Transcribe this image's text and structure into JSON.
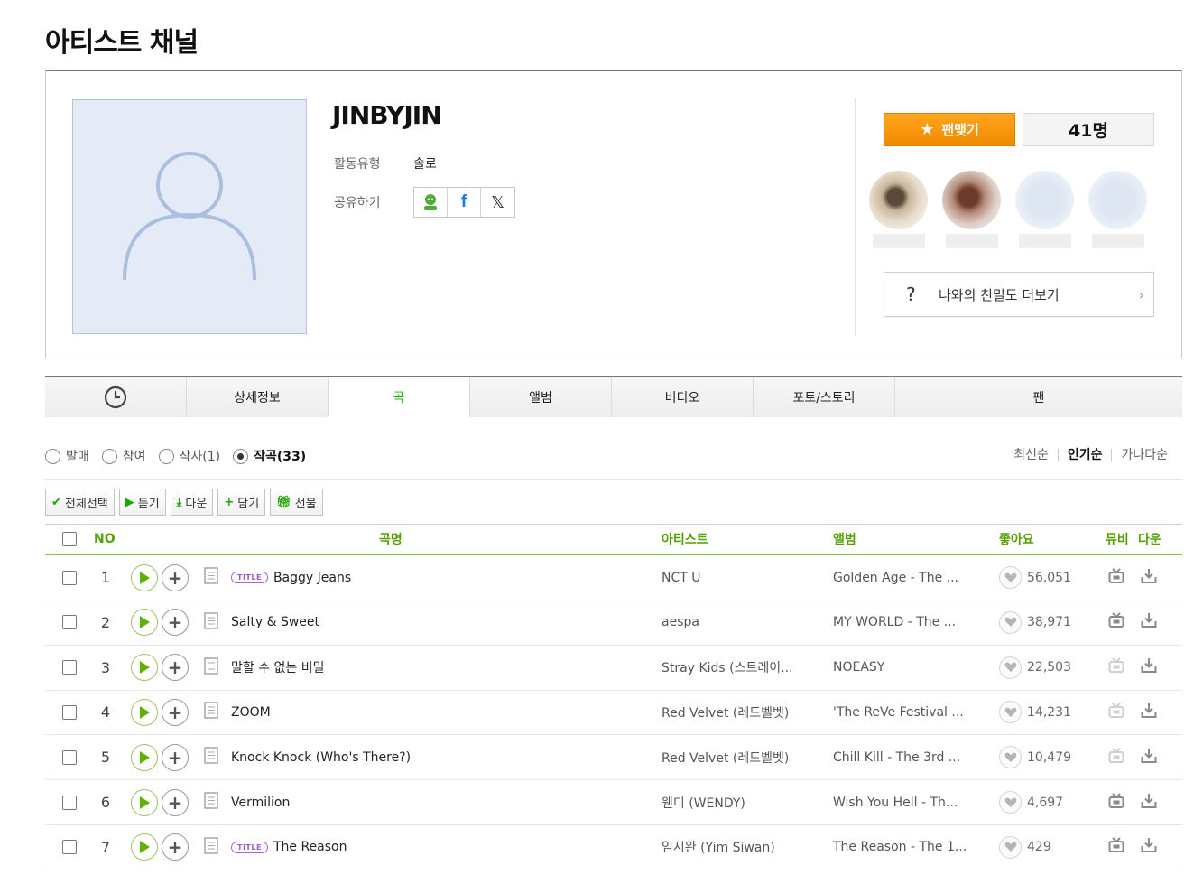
{
  "page_title": "아티스트 채널",
  "artist": {
    "name": "JINBYJIN",
    "activity_label": "활동유형",
    "activity_value": "솔로",
    "share_label": "공유하기"
  },
  "fan": {
    "button_label": "팬맺기",
    "count": "41명",
    "closeness_label": "나와의 친밀도 더보기"
  },
  "tabs": [
    {
      "label": ""
    },
    {
      "label": "상세정보"
    },
    {
      "label": "곡"
    },
    {
      "label": "앨범"
    },
    {
      "label": "비디오"
    },
    {
      "label": "포토/스토리"
    },
    {
      "label": "팬"
    }
  ],
  "filters": [
    {
      "label": "발매",
      "selected": false
    },
    {
      "label": "참여",
      "selected": false
    },
    {
      "label": "작사(1)",
      "selected": false
    },
    {
      "label": "작곡(33)",
      "selected": true
    }
  ],
  "sorts": [
    {
      "label": "최신순",
      "selected": false
    },
    {
      "label": "인기순",
      "selected": true
    },
    {
      "label": "가나다순",
      "selected": false
    }
  ],
  "actions": {
    "select_all": "전체선택",
    "listen": "듣기",
    "download": "다운",
    "add": "담기",
    "gift": "선물"
  },
  "table": {
    "headers": {
      "no": "NO",
      "song": "곡명",
      "artist": "아티스트",
      "album": "앨범",
      "like": "좋아요",
      "mv": "뮤비",
      "down": "다운"
    },
    "title_badge": "TITLE",
    "rows": [
      {
        "no": "1",
        "song": "Baggy Jeans",
        "title": true,
        "artist": "NCT U",
        "album": "Golden Age - The ...",
        "likes": "56,051",
        "mv": true
      },
      {
        "no": "2",
        "song": "Salty & Sweet",
        "title": false,
        "artist": "aespa",
        "album": "MY WORLD - The ...",
        "likes": "38,971",
        "mv": true
      },
      {
        "no": "3",
        "song": "말할 수 없는 비밀",
        "title": false,
        "artist": "Stray Kids (스트레이...",
        "album": "NOEASY",
        "likes": "22,503",
        "mv": false
      },
      {
        "no": "4",
        "song": "ZOOM",
        "title": false,
        "artist": "Red Velvet (레드벨벳)",
        "album": "'The ReVe Festival ...",
        "likes": "14,231",
        "mv": false
      },
      {
        "no": "5",
        "song": "Knock Knock (Who's There?)",
        "title": false,
        "artist": "Red Velvet (레드벨벳)",
        "album": "Chill Kill - The 3rd ...",
        "likes": "10,479",
        "mv": false
      },
      {
        "no": "6",
        "song": "Vermilion",
        "title": false,
        "artist": "웬디 (WENDY)",
        "album": "Wish You Hell - Th...",
        "likes": "4,697",
        "mv": true
      },
      {
        "no": "7",
        "song": "The Reason",
        "title": true,
        "artist": "임시완 (Yim Siwan)",
        "album": "The Reason - The 1...",
        "likes": "429",
        "mv": true
      }
    ]
  },
  "colors": {
    "accent_green": "#1bb200",
    "fan_orange": "#f59300",
    "title_purple": "#9a59cc"
  }
}
